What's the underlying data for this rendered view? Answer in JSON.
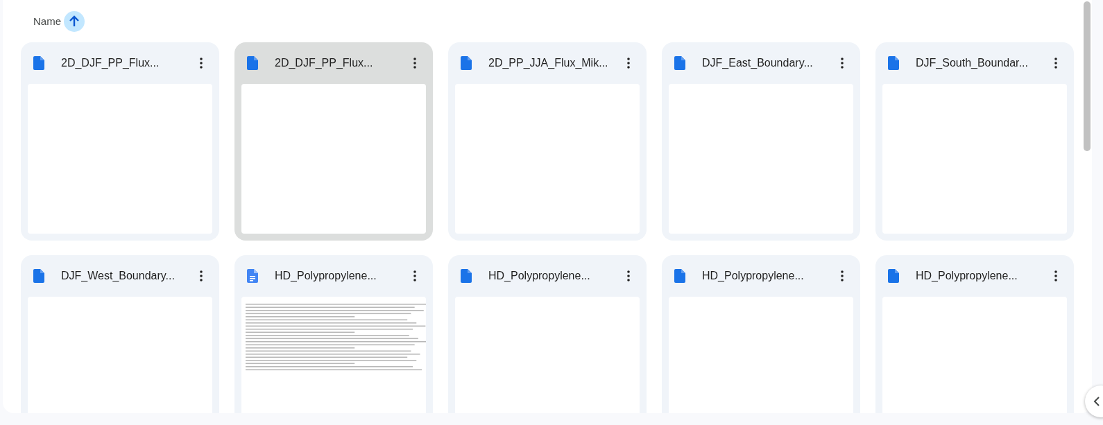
{
  "sort": {
    "label": "Name"
  },
  "files": [
    {
      "name": "2D_DJF_PP_Flux...",
      "kind": "file",
      "selected": false
    },
    {
      "name": "2D_DJF_PP_Flux...",
      "kind": "file",
      "selected": true
    },
    {
      "name": "2D_PP_JJA_Flux_Mik...",
      "kind": "file",
      "selected": false
    },
    {
      "name": "DJF_East_Boundary...",
      "kind": "file",
      "selected": false
    },
    {
      "name": "DJF_South_Boundar...",
      "kind": "file",
      "selected": false
    },
    {
      "name": "DJF_West_Boundary...",
      "kind": "file",
      "selected": false
    },
    {
      "name": "HD_Polypropylene...",
      "kind": "doc",
      "selected": false
    },
    {
      "name": "HD_Polypropylene...",
      "kind": "file",
      "selected": false
    },
    {
      "name": "HD_Polypropylene...",
      "kind": "file",
      "selected": false
    },
    {
      "name": "HD_Polypropylene...",
      "kind": "file",
      "selected": false
    }
  ]
}
